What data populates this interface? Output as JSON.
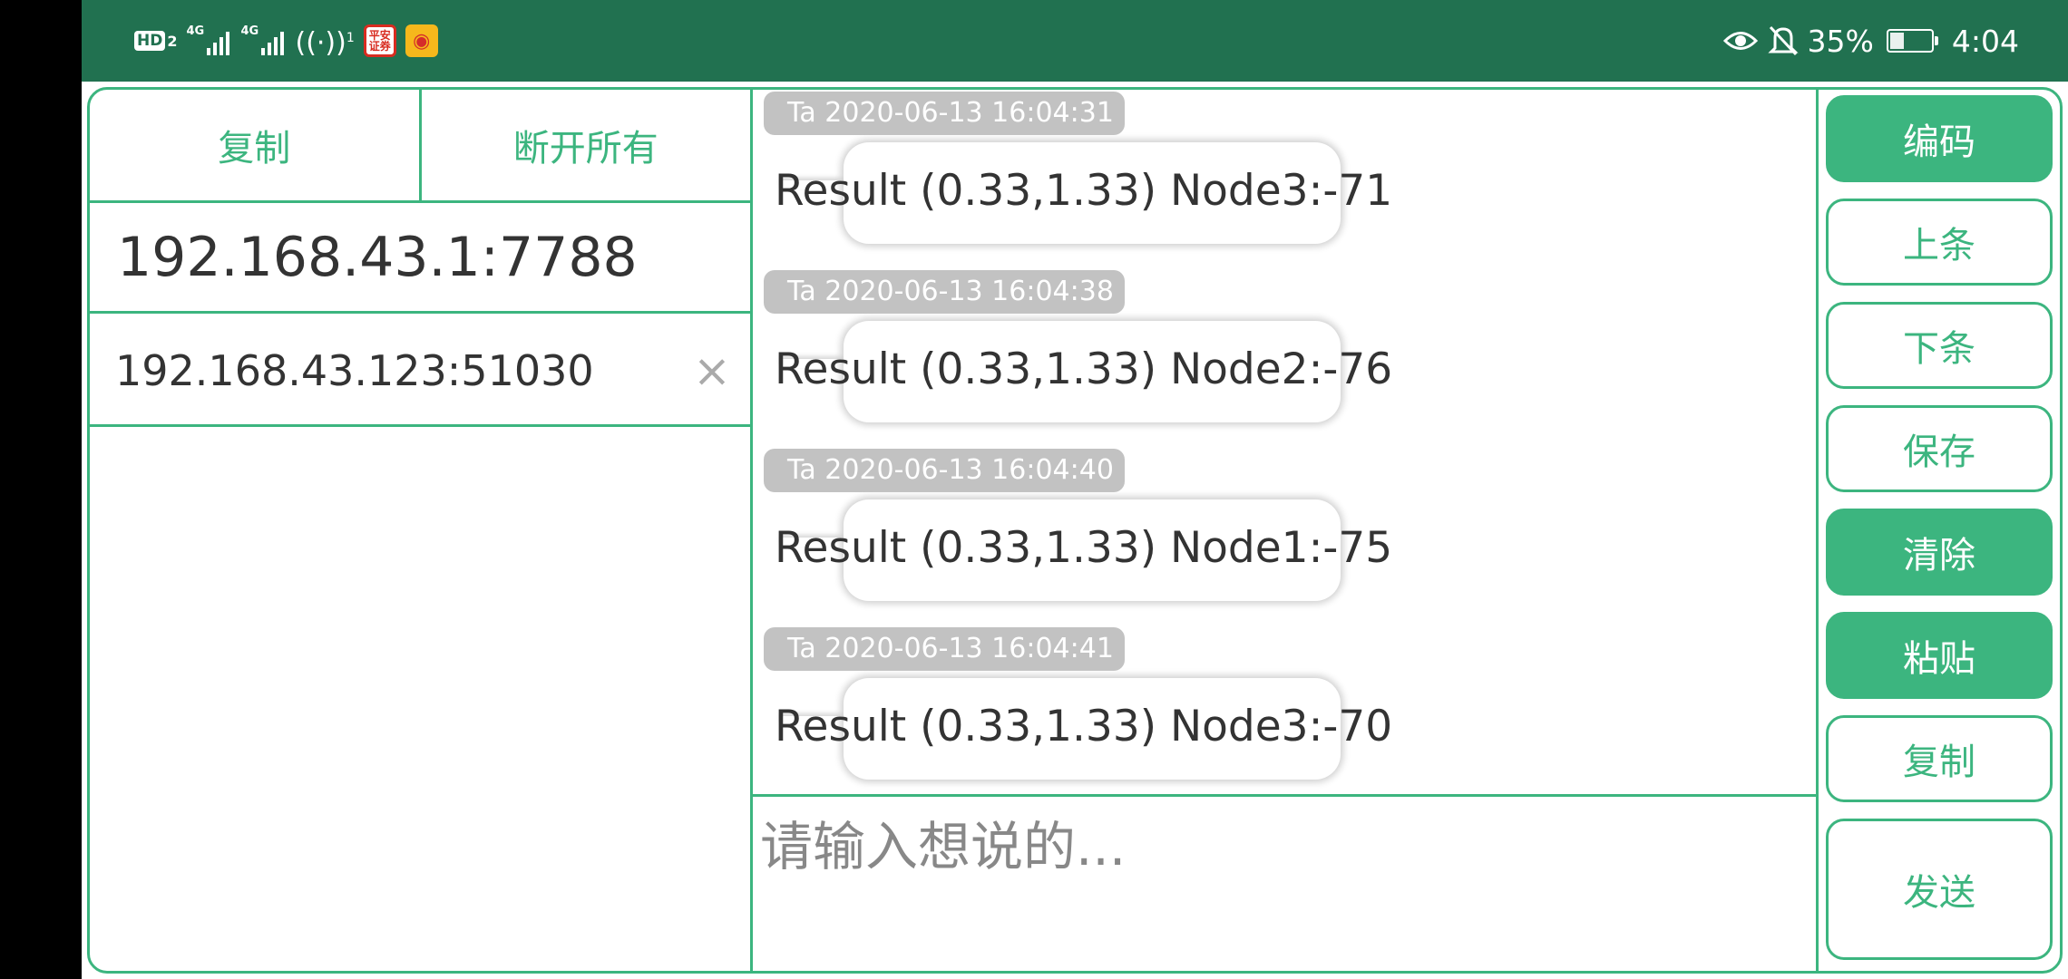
{
  "status_bar": {
    "hd_label": "HD",
    "sim_number": "2",
    "signal_labels": [
      "4G",
      "4G"
    ],
    "hotspot_count": "1",
    "app_badge_text": "平安\n证券",
    "battery_percent": "35%",
    "battery_level": 0.35,
    "time": "4:04",
    "icons": [
      "hd-icon",
      "signal-icon",
      "signal-icon",
      "hotspot-icon",
      "pingan-app-icon",
      "weibo-app-icon",
      "eye-comfort-icon",
      "mute-bell-icon",
      "battery-icon"
    ]
  },
  "left_panel": {
    "copy_label": "复制",
    "disconnect_label": "断开所有",
    "local_address": "192.168.43.1:7788",
    "clients": [
      {
        "address": "192.168.43.123:51030",
        "close_icon": "×"
      }
    ]
  },
  "messages": [
    {
      "sender": "Ta",
      "time": "2020-06-13 16:04:31",
      "text": "Result (0.33,1.33) Node3:-71"
    },
    {
      "sender": "Ta",
      "time": "2020-06-13 16:04:38",
      "text": "Result (0.33,1.33) Node2:-76"
    },
    {
      "sender": "Ta",
      "time": "2020-06-13 16:04:40",
      "text": "Result (0.33,1.33) Node1:-75"
    },
    {
      "sender": "Ta",
      "time": "2020-06-13 16:04:41",
      "text": "Result (0.33,1.33) Node3:-70"
    }
  ],
  "input": {
    "placeholder": "请输入想说的...",
    "value": ""
  },
  "right_panel": {
    "encode_label": "编码",
    "prev_label": "上条",
    "next_label": "下条",
    "save_label": "保存",
    "clear_label": "清除",
    "paste_label": "粘贴",
    "copy_label": "复制",
    "send_label": "发送"
  },
  "colors": {
    "status_bar": "#217150",
    "accent": "#3cb57f",
    "timestamp_bg": "#c2c2c2",
    "text": "#333333"
  }
}
